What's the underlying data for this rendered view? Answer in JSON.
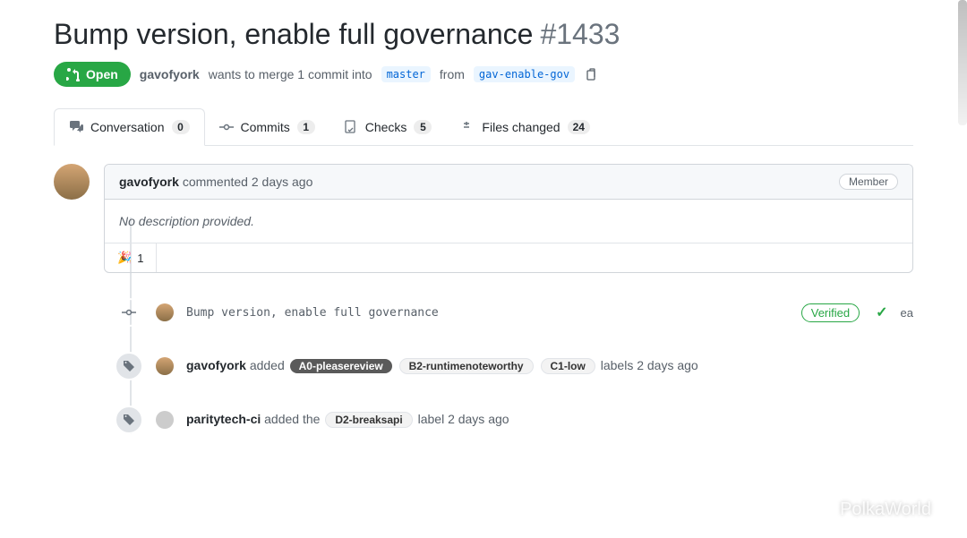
{
  "pr": {
    "title": "Bump version, enable full governance",
    "number": "#1433",
    "state": "Open",
    "author": "gavofyork",
    "merge_text_1": "wants to merge 1 commit into",
    "base_branch": "master",
    "merge_text_2": "from",
    "compare_branch": "gav-enable-gov"
  },
  "tabs": {
    "conversation": {
      "label": "Conversation",
      "count": "0"
    },
    "commits": {
      "label": "Commits",
      "count": "1"
    },
    "checks": {
      "label": "Checks",
      "count": "5"
    },
    "files": {
      "label": "Files changed",
      "count": "24"
    }
  },
  "comment": {
    "author": "gavofyork",
    "action": "commented",
    "time": "2 days ago",
    "role": "Member",
    "body": "No description provided.",
    "reaction_count": "1"
  },
  "timeline": {
    "commit": {
      "message": "Bump version, enable full governance",
      "verified": "Verified",
      "sha_fragment": "ea"
    },
    "label_event_1": {
      "actor": "gavofyork",
      "verb": "added",
      "labels": [
        "A0-pleasereview",
        "B2-runtimenoteworthy",
        "C1-low"
      ],
      "suffix": "labels 2 days ago"
    },
    "label_event_2": {
      "actor": "paritytech-ci",
      "verb": "added the",
      "labels": [
        "D2-breaksapi"
      ],
      "suffix": "label 2 days ago"
    }
  },
  "watermark": "PolkaWorld"
}
